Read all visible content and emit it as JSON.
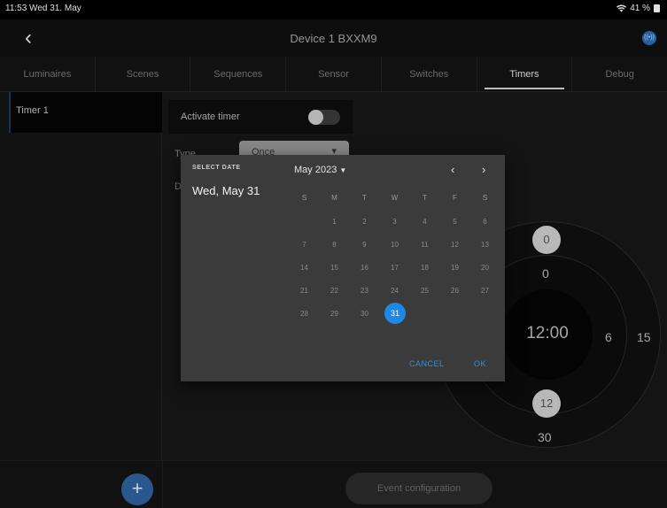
{
  "status": {
    "time": "11:53  Wed 31. May",
    "battery": "41 %"
  },
  "header": {
    "back_icon": "chevron-left-icon",
    "title": "Device 1 BXXM9",
    "status_icon": "link-icon"
  },
  "tabs": [
    {
      "label": "Luminaires"
    },
    {
      "label": "Scenes"
    },
    {
      "label": "Sequences"
    },
    {
      "label": "Sensor"
    },
    {
      "label": "Switches"
    },
    {
      "label": "Timers",
      "active": true
    },
    {
      "label": "Debug"
    }
  ],
  "timers": [
    {
      "label": "Timer 1",
      "selected": true
    }
  ],
  "form": {
    "activate_label": "Activate timer",
    "activate_on": false,
    "type_label": "Type",
    "type_value": "Once",
    "date_label": "D"
  },
  "dial": {
    "center_time": "12:00",
    "top_knob": "0",
    "top_label": "0",
    "bottom_knob": "12",
    "bottom_label": "30",
    "right_inner": "6",
    "right_outer": "15"
  },
  "bottom": {
    "add_label": "+",
    "event_config_label": "Event configuration"
  },
  "date_picker": {
    "select_label": "SELECT DATE",
    "selected_date": "Wed, May 31",
    "month_label": "May 2023",
    "weekdays": [
      "S",
      "M",
      "T",
      "W",
      "T",
      "F",
      "S"
    ],
    "weeks": [
      [
        "",
        "1",
        "2",
        "3",
        "4",
        "5",
        "6"
      ],
      [
        "7",
        "8",
        "9",
        "10",
        "11",
        "12",
        "13"
      ],
      [
        "14",
        "15",
        "16",
        "17",
        "18",
        "19",
        "20"
      ],
      [
        "21",
        "22",
        "23",
        "24",
        "25",
        "26",
        "27"
      ],
      [
        "28",
        "29",
        "30",
        "31",
        "",
        "",
        ""
      ]
    ],
    "selected_day": "31",
    "cancel_label": "CANCEL",
    "ok_label": "OK",
    "accent_color": "#1e88e5"
  }
}
